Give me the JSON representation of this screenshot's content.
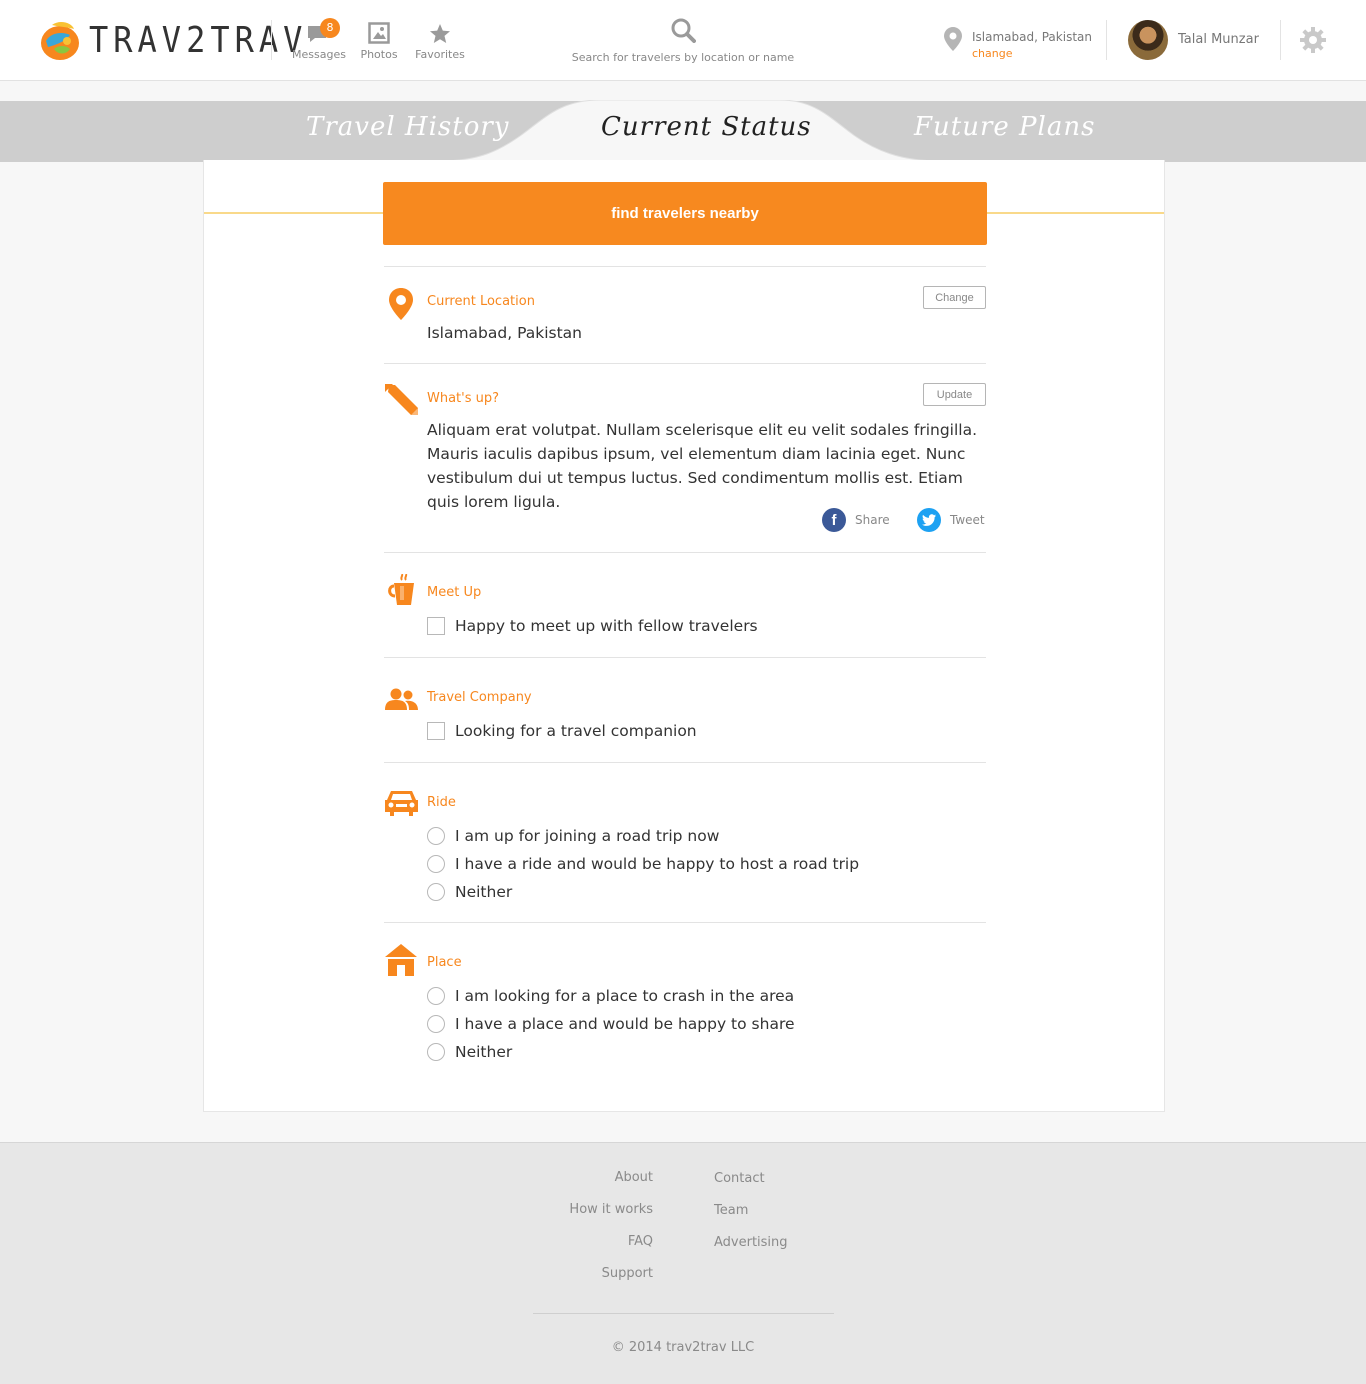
{
  "header": {
    "logo_text": "TRAV2TRAV",
    "nav": [
      {
        "label": "Messages",
        "badge": "8",
        "icon": "speech-bubble-icon"
      },
      {
        "label": "Photos",
        "icon": "photo-icon"
      },
      {
        "label": "Favorites",
        "icon": "star-icon"
      }
    ],
    "search_placeholder": "Search for travelers by location or name",
    "location": "Islamabad, Pakistan",
    "location_change": "change",
    "user_name": "Talal Munzar"
  },
  "tabs": {
    "history": "Travel History",
    "current": "Current Status",
    "future": "Future Plans"
  },
  "main": {
    "find_button": "find travelers nearby",
    "current_location": {
      "title": "Current Location",
      "value": "Islamabad, Pakistan",
      "button": "Change"
    },
    "whats_up": {
      "title": "What's up?",
      "text": "Aliquam erat volutpat. Nullam scelerisque elit eu velit sodales fringilla. Mauris iaculis dapibus ipsum, vel elementum diam lacinia eget. Nunc vestibulum dui ut tempus luctus. Sed condimentum mollis est. Etiam quis lorem ligula.",
      "button": "Update",
      "share": "Share",
      "tweet": "Tweet"
    },
    "meet_up": {
      "title": "Meet Up",
      "option": "Happy to meet up with fellow travelers"
    },
    "travel_company": {
      "title": "Travel Company",
      "option": "Looking for a travel companion"
    },
    "ride": {
      "title": "Ride",
      "options": [
        "I am up for joining a road trip now",
        "I have a ride and would be happy to host a road trip",
        "Neither"
      ]
    },
    "place": {
      "title": "Place",
      "options": [
        "I am looking for a place to crash in the area",
        "I have a place and would be happy to share",
        "Neither"
      ]
    }
  },
  "footer": {
    "col1": [
      "About",
      "How it works",
      "FAQ",
      "Support"
    ],
    "col2": [
      "Contact",
      "Team",
      "Advertising"
    ],
    "copyright": "© 2014 trav2trav LLC"
  },
  "colors": {
    "accent": "#f7871e",
    "facebook": "#3b5998",
    "twitter": "#1da1f2"
  }
}
